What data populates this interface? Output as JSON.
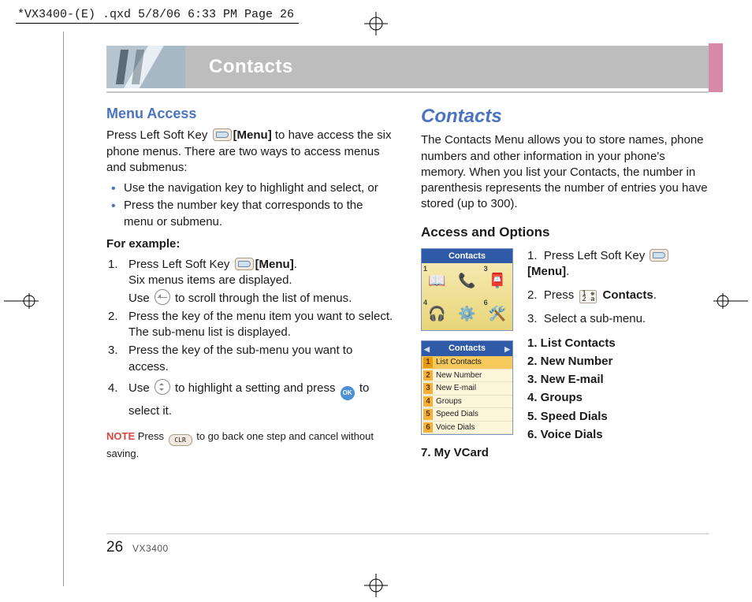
{
  "slug": "*VX3400-(E) .qxd  5/8/06  6:33 PM  Page 26",
  "banner": {
    "title": "Contacts"
  },
  "footer": {
    "page": "26",
    "model": "VX3400"
  },
  "left": {
    "h1": "Menu Access",
    "intro_a": "Press Left Soft Key ",
    "intro_b": "[Menu]",
    "intro_c": " to have access the six phone menus. There are two ways to access menus and submenus:",
    "bullets": [
      "Use the navigation key to highlight and select, or",
      "Press the number key that corresponds to the menu or submenu."
    ],
    "example_h": "For example:",
    "step1a": "Press Left Soft Key ",
    "step1b": "[Menu]",
    "step1c": ".",
    "step1d": "Six menus items are displayed.",
    "step1e": "Use ",
    "step1f": " to scroll through the list of menus.",
    "step2a": "Press the key of the menu item you want to select.",
    "step2b": "The sub-menu list is displayed.",
    "step3": "Press the key of the sub-menu you want to access.",
    "step4a": "Use ",
    "step4b": " to highlight a setting and press ",
    "step4c": " to select it.",
    "note_label": "NOTE",
    "note_a": " Press ",
    "note_b": " to go back one step and cancel without saving."
  },
  "right": {
    "h1": "Contacts",
    "p1": "The Contacts Menu allows you to store names, phone numbers and other information in your phone's memory. When you list your Contacts, the number in parenthesis represents the number of entries you have stored (up to 300).",
    "h2": "Access and Options",
    "screen_icons_title": "Contacts",
    "screen_icons_corners": [
      "1",
      "3",
      "4",
      "6"
    ],
    "screen_list_title": "Contacts",
    "screen_list": [
      {
        "n": "1",
        "label": "List Contacts"
      },
      {
        "n": "2",
        "label": "New Number"
      },
      {
        "n": "3",
        "label": "New E-mail"
      },
      {
        "n": "4",
        "label": "Groups"
      },
      {
        "n": "5",
        "label": "Speed Dials"
      },
      {
        "n": "6",
        "label": "Voice Dials"
      }
    ],
    "steps": {
      "s1a": "Press Left Soft Key ",
      "s1b": "[Menu]",
      "s1c": ".",
      "s2a": "Press ",
      "s2b": "Contacts",
      "s2c": ".",
      "s3": "Select a sub-menu."
    },
    "submenu": [
      "1.  List Contacts",
      "2.  New Number",
      "3.  New E-mail",
      "4.  Groups",
      "5.  Speed Dials",
      "6.  Voice Dials",
      "7.  My VCard"
    ]
  },
  "icons": {
    "key12_top": "1 ❋",
    "key12_bot": "2 a",
    "ok": "OK",
    "clr": "CLR"
  }
}
